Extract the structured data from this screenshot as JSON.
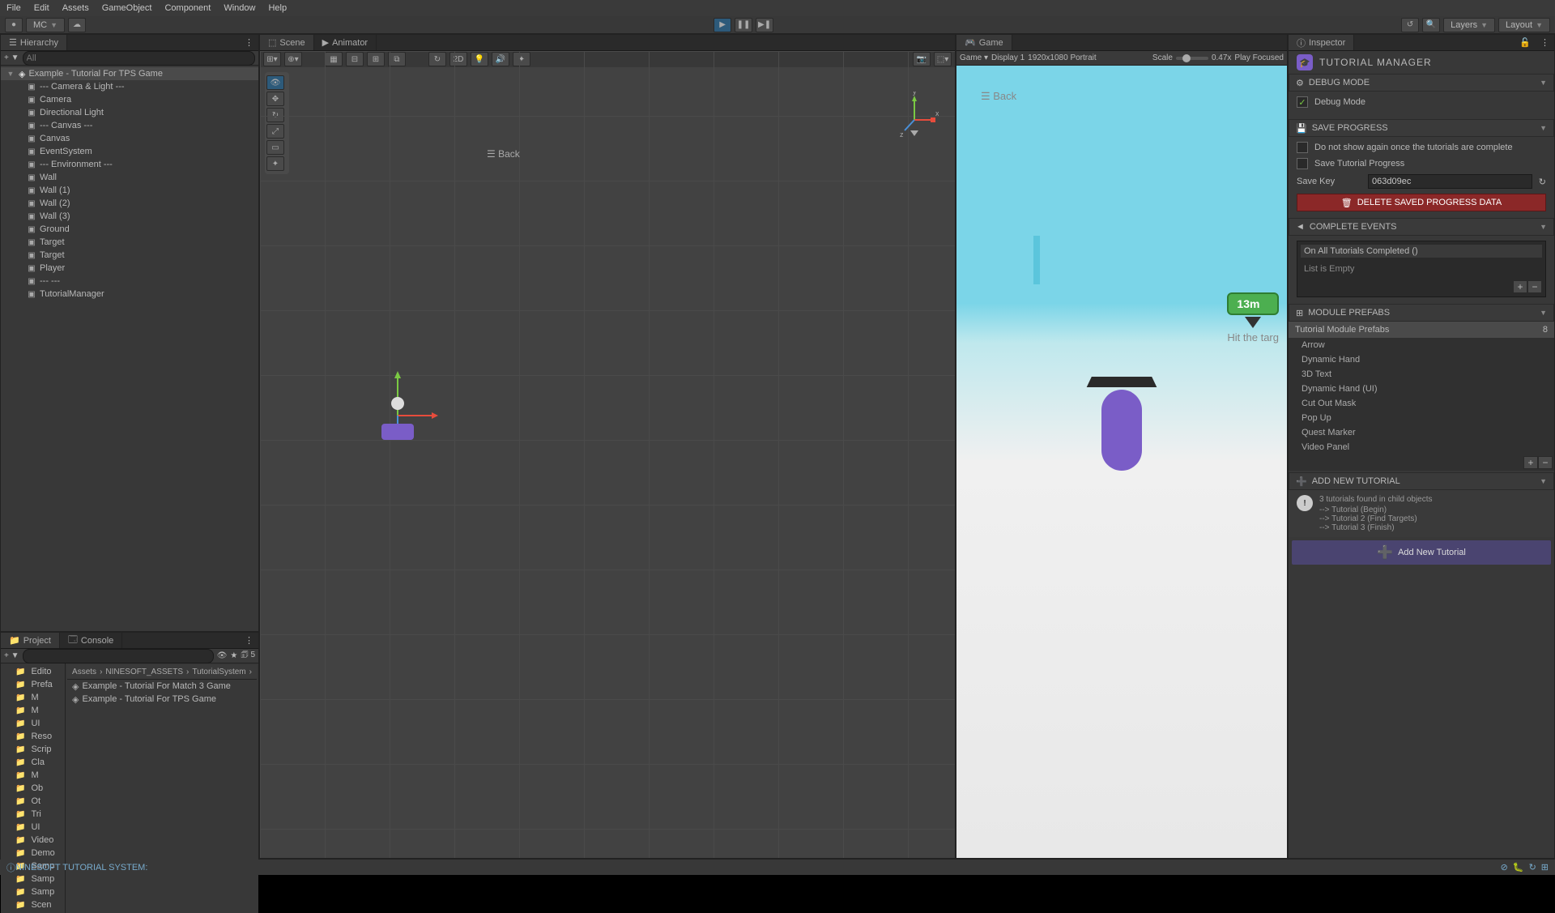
{
  "menubar": [
    "File",
    "Edit",
    "Assets",
    "GameObject",
    "Component",
    "Window",
    "Help"
  ],
  "toolbar": {
    "account": "MC",
    "layers": "Layers",
    "layout": "Layout"
  },
  "hierarchy": {
    "tab": "Hierarchy",
    "search_placeholder": "All",
    "root": "Example - Tutorial For TPS Game",
    "items": [
      {
        "label": "--- Camera & Light ---",
        "indent": 1
      },
      {
        "label": "Camera",
        "indent": 1
      },
      {
        "label": "Directional Light",
        "indent": 1
      },
      {
        "label": "--- Canvas ---",
        "indent": 1
      },
      {
        "label": "Canvas",
        "indent": 1
      },
      {
        "label": "EventSystem",
        "indent": 1
      },
      {
        "label": "--- Environment ---",
        "indent": 1
      },
      {
        "label": "Wall",
        "indent": 1
      },
      {
        "label": "Wall (1)",
        "indent": 1
      },
      {
        "label": "Wall (2)",
        "indent": 1
      },
      {
        "label": "Wall (3)",
        "indent": 1
      },
      {
        "label": "Ground",
        "indent": 1
      },
      {
        "label": "Target",
        "indent": 1
      },
      {
        "label": "Target",
        "indent": 1
      },
      {
        "label": "Player",
        "indent": 1
      },
      {
        "label": "--- ---",
        "indent": 1
      },
      {
        "label": "TutorialManager",
        "indent": 1
      }
    ]
  },
  "scene": {
    "tab": "Scene",
    "tab2": "Animator",
    "toolbar_2d": "2D",
    "back": "☰ Back"
  },
  "game": {
    "tab": "Game",
    "display": "Display 1",
    "resolution": "1920x1080 Portrait",
    "scale_label": "Scale",
    "scale_value": "0.47x",
    "play_mode": "Play Focused",
    "distance": "13m",
    "hit_text": "Hit the targ"
  },
  "inspector": {
    "tab": "Inspector",
    "title": "TUTORIAL MANAGER",
    "debug_header": "DEBUG MODE",
    "debug_mode": "Debug Mode",
    "save_header": "SAVE PROGRESS",
    "do_not_show": "Do not show again once the tutorials are complete",
    "save_progress": "Save Tutorial Progress",
    "save_key_label": "Save Key",
    "save_key_value": "063d09ec",
    "delete_btn": "DELETE SAVED PROGRESS DATA",
    "complete_header": "COMPLETE EVENTS",
    "on_complete": "On All Tutorials Completed ()",
    "list_empty": "List is Empty",
    "module_header": "MODULE PREFABS",
    "prefabs_title": "Tutorial Module Prefabs",
    "prefabs": [
      "Arrow",
      "Dynamic Hand",
      "3D Text",
      "Dynamic Hand (UI)",
      "Cut Out Mask",
      "Pop Up",
      "Quest Marker",
      "Video Panel"
    ],
    "add_tutorial_header": "ADD NEW TUTORIAL",
    "tutorials_found": "3 tutorials found in child objects",
    "tutorial_list": [
      "--> Tutorial (Begin)",
      "--> Tutorial 2 (Find Targets)",
      "--> Tutorial 3 (Finish)"
    ],
    "add_btn": "Add New Tutorial"
  },
  "project": {
    "tab": "Project",
    "tab2": "Console",
    "filter_count": "5",
    "breadcrumb": [
      "Assets",
      "NINESOFT_ASSETS",
      "TutorialSystem"
    ],
    "tree": [
      "Edito",
      "Prefa",
      "M",
      "M",
      "UI",
      "Reso",
      "Scrip",
      "Cla",
      "M",
      "Ob",
      "Ot",
      "Tri",
      "UI",
      "Video",
      "Demo",
      "Samp",
      "Samp",
      "Samp",
      "Scen"
    ],
    "files": [
      "Example - Tutorial For Match 3 Game",
      "Example - Tutorial For TPS Game"
    ]
  },
  "status": {
    "message": "NINESOFT TUTORIAL SYSTEM:"
  }
}
